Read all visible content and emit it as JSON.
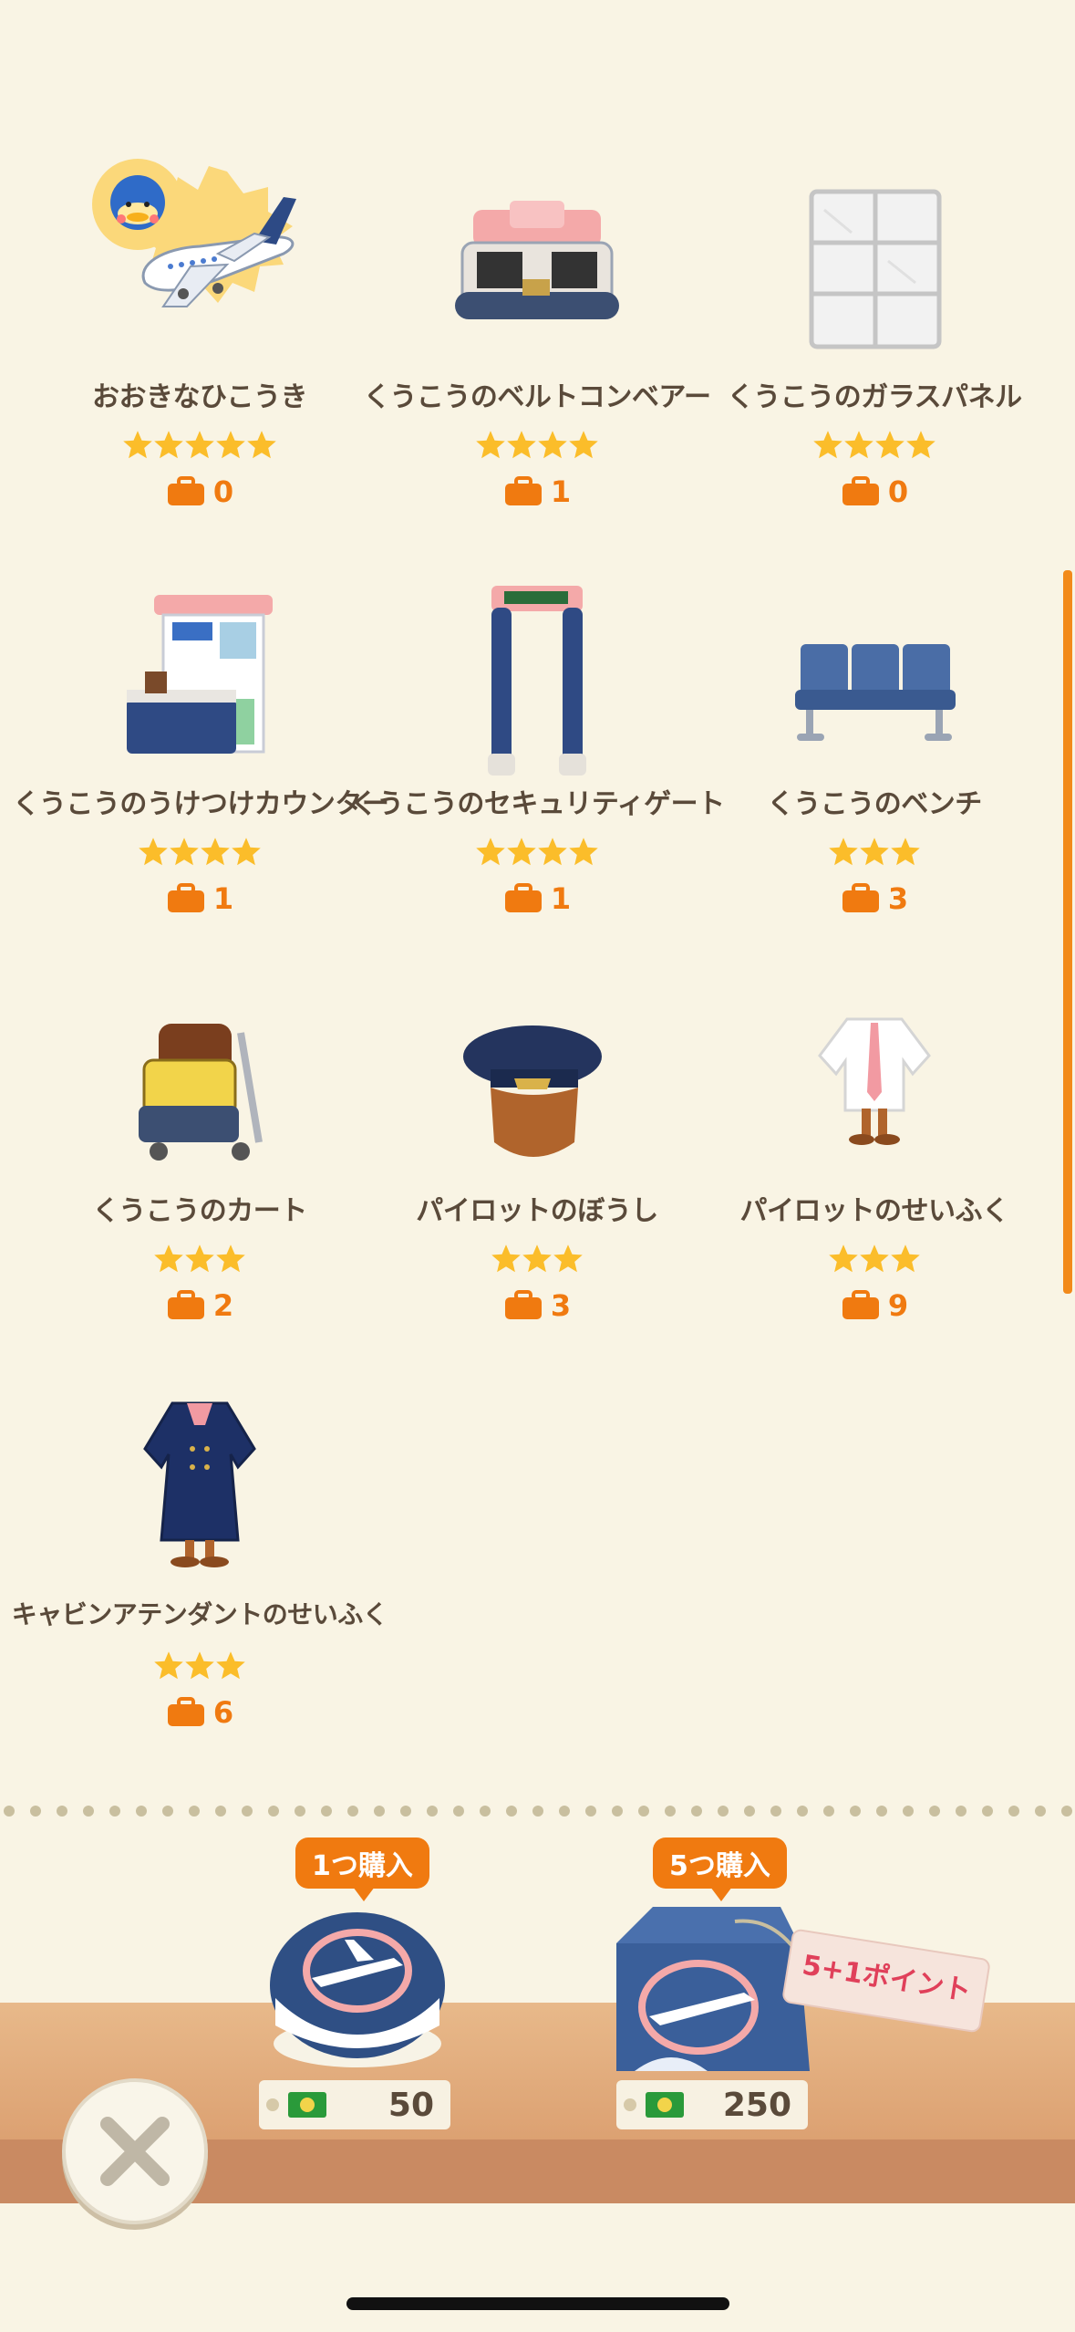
{
  "items": [
    {
      "name": "おおきなひこうき",
      "stars": 5,
      "owned": "0",
      "icon": "airplane-icon"
    },
    {
      "name": "くうこうのベルトコンベアー",
      "stars": 4,
      "owned": "1",
      "icon": "conveyor-icon"
    },
    {
      "name": "くうこうのガラスパネル",
      "stars": 4,
      "owned": "0",
      "icon": "glass-panel-icon"
    },
    {
      "name": "くうこうのうけつけカウンター",
      "stars": 4,
      "owned": "1",
      "icon": "counter-icon"
    },
    {
      "name": "くうこうのセキュリティゲート",
      "stars": 4,
      "owned": "1",
      "icon": "security-gate-icon"
    },
    {
      "name": "くうこうのベンチ",
      "stars": 3,
      "owned": "3",
      "icon": "bench-icon"
    },
    {
      "name": "くうこうのカート",
      "stars": 3,
      "owned": "2",
      "icon": "cart-icon"
    },
    {
      "name": "パイロットのぼうし",
      "stars": 3,
      "owned": "3",
      "icon": "pilot-hat-icon"
    },
    {
      "name": "パイロットのせいふく",
      "stars": 3,
      "owned": "9",
      "icon": "pilot-uniform-icon"
    },
    {
      "name": "キャビンアテンダントのせいふく",
      "stars": 3,
      "owned": "6",
      "icon": "attendant-uniform-icon"
    }
  ],
  "shop": {
    "single": {
      "label": "1つ購入",
      "price": "50"
    },
    "bundle": {
      "label": "5つ購入",
      "price": "250",
      "bonus": "5+1ポイント"
    }
  },
  "colors": {
    "accent": "#f07a10",
    "star": "#fbbd2a",
    "background": "#f9f4e4"
  }
}
